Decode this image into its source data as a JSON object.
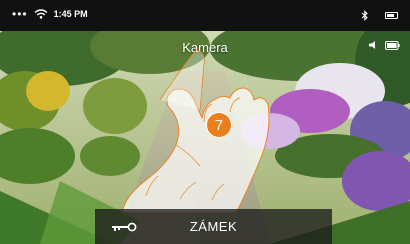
{
  "status_bar": {
    "time": "1:45 PM",
    "signal_icon": "dots-icon",
    "wifi_icon": "wifi-icon",
    "bluetooth_icon": "bluetooth-icon",
    "battery_icon": "battery-icon",
    "battery_level": 0.8
  },
  "header": {
    "title": "Kamera",
    "speaker_icon": "speaker-icon",
    "device_battery_icon": "battery-icon"
  },
  "callout": {
    "step_number": "7",
    "gesture_icon": "tap-hand-icon"
  },
  "lock_bar": {
    "icon": "key-icon",
    "label": "ZÁMEK"
  },
  "colors": {
    "status_bar_bg": "#111111",
    "accent": "#ea7f1b",
    "lock_bar_bg": "#1c1c1c",
    "text": "#ffffff"
  }
}
